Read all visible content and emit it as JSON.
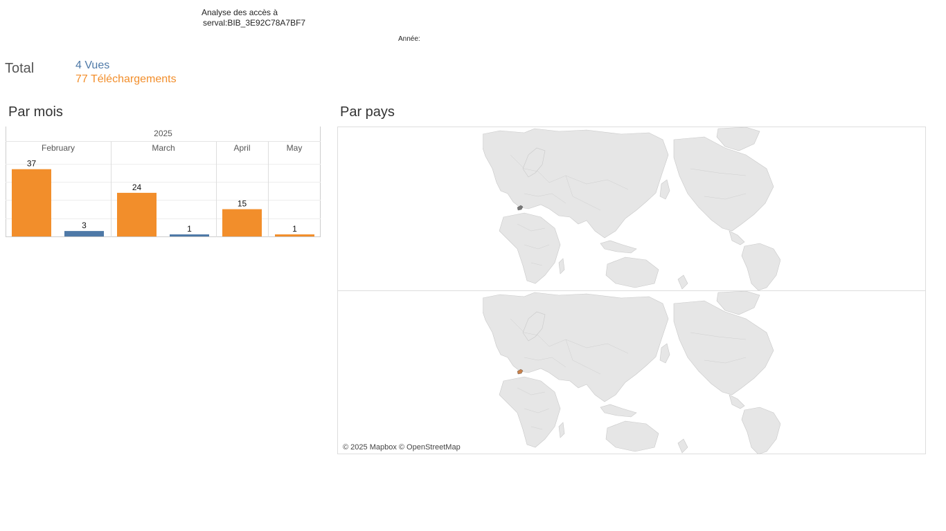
{
  "header": {
    "title_line1": "Analyse des accès à",
    "title_line2": "serval:BIB_3E92C78A7BF7",
    "year_filter_label": "Année:"
  },
  "totals": {
    "label": "Total",
    "views": "4 Vues",
    "downloads": "77 Téléchargements"
  },
  "sections": {
    "by_month": "Par mois",
    "by_country": "Par pays"
  },
  "colors": {
    "views": "#4e79a7",
    "downloads": "#f28e2b"
  },
  "chart_data": {
    "type": "bar",
    "year": "2025",
    "categories": [
      "February",
      "March",
      "April",
      "May"
    ],
    "series": [
      {
        "key": "downloads",
        "values": [
          37,
          24,
          15,
          1
        ]
      },
      {
        "key": "views",
        "values": [
          3,
          1,
          0,
          0
        ]
      }
    ],
    "bars": [
      {
        "month": "February",
        "key": "downloads",
        "value": 37
      },
      {
        "month": "February",
        "key": "views",
        "value": 3
      },
      {
        "month": "March",
        "key": "downloads",
        "value": 24
      },
      {
        "month": "March",
        "key": "views",
        "value": 1
      },
      {
        "month": "April",
        "key": "downloads",
        "value": 15
      },
      {
        "month": "May",
        "key": "downloads",
        "value": 1
      }
    ],
    "ylim": [
      0,
      40
    ],
    "grid": true
  },
  "map": {
    "attribution": "© 2025 Mapbox © OpenStreetMap",
    "panels": [
      {
        "name": "views-map",
        "highlight_color": "#777777"
      },
      {
        "name": "downloads-map",
        "highlight_color": "#c8804a"
      }
    ]
  }
}
